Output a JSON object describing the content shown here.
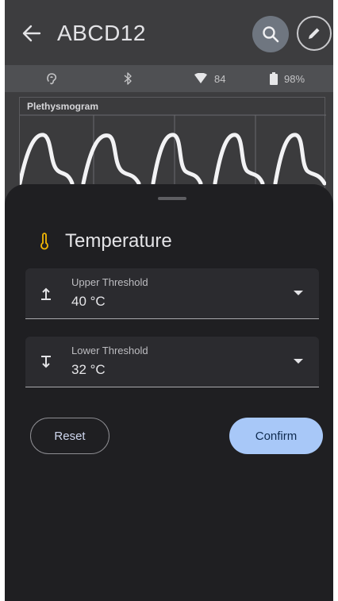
{
  "app_bar": {
    "title": "ABCD12",
    "icons": [
      "arrow-left-icon",
      "search-icon",
      "pencil-icon"
    ]
  },
  "status_bar": {
    "hearing_icon": "ear-icon",
    "bluetooth_icon": "bluetooth-icon",
    "wifi_value": "84",
    "battery_value": "98%"
  },
  "plethysmogram": {
    "label": "Plethysmogram"
  },
  "sheet": {
    "title": "Temperature",
    "title_icon": "thermometer-icon",
    "accent_color": "#f2b705",
    "fields": [
      {
        "label": "Upper Threshold",
        "value": "40 °C",
        "icon": "upper-threshold-icon"
      },
      {
        "label": "Lower Threshold",
        "value": "32 °C",
        "icon": "lower-threshold-icon"
      }
    ],
    "reset_label": "Reset",
    "confirm_label": "Confirm"
  }
}
